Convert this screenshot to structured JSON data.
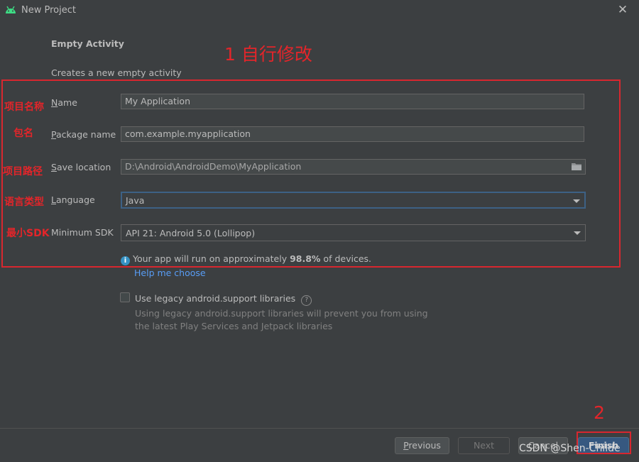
{
  "window": {
    "title": "New Project",
    "close_glyph": "✕",
    "app_icon": "android-icon"
  },
  "page": {
    "heading": "Empty Activity",
    "subheading": "Creates a new empty activity"
  },
  "form": {
    "name": {
      "label_first": "N",
      "label_rest": "ame",
      "value": "My Application"
    },
    "package": {
      "label_first": "P",
      "label_rest": "ackage name",
      "value": "com.example.myapplication"
    },
    "save_location": {
      "label_first": "S",
      "label_rest": "ave location",
      "value": "D:\\Android\\AndroidDemo\\MyApplication"
    },
    "language": {
      "label_first": "L",
      "label_rest": "anguage",
      "value": "Java"
    },
    "min_sdk": {
      "label": "Minimum SDK",
      "value": "API 21: Android 5.0 (Lollipop)"
    }
  },
  "info": {
    "prefix": "Your app will run on approximately ",
    "percent": "98.8%",
    "suffix": " of devices.",
    "help_link": "Help me choose"
  },
  "legacy": {
    "label": "Use legacy android.support libraries",
    "help_glyph": "?",
    "desc_line1": "Using legacy android.support libraries will prevent you from using",
    "desc_line2": "the latest Play Services and Jetpack libraries",
    "checked": false
  },
  "footer": {
    "previous_first": "P",
    "previous_rest": "revious",
    "next": "Next",
    "cancel": "Cancel",
    "finish": "Finish"
  },
  "annotations": {
    "step1": "1 自行修改",
    "step2": "2",
    "project_name": "项目名称",
    "package_name": "包名",
    "project_path": "项目路径",
    "language_type": "语言类型",
    "min_sdk": "最小SDK",
    "color": "#e3252a"
  },
  "watermark": "CSDN @Shen-Childe"
}
